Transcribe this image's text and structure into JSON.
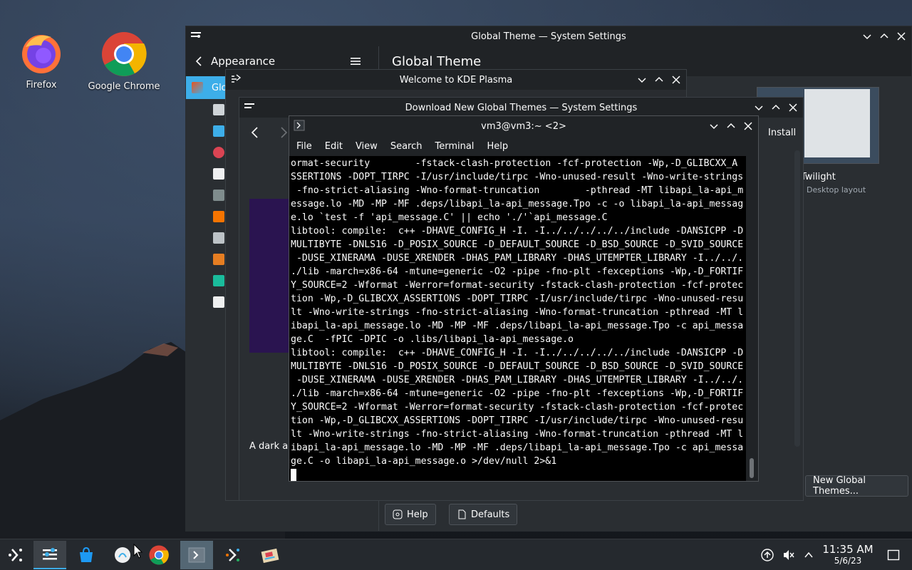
{
  "desktop": {
    "icons": [
      {
        "label": "Firefox"
      },
      {
        "label": "Google Chrome"
      }
    ]
  },
  "system_settings": {
    "title": "Global Theme — System Settings",
    "back_label": "Appearance",
    "page_title": "Global Theme",
    "sidebar_first_item": "Glo",
    "install_label": "Install",
    "theme_name": "ze Twilight",
    "theme_sub": "Desktop layout",
    "get_new_label": "New Global Themes...",
    "help_label": "Help",
    "defaults_label": "Defaults",
    "theme_desc_partial": "A dark an",
    "colors": {
      "accent": "#3daee9",
      "bg": "#202326",
      "panel": "#2a2e32"
    }
  },
  "welcome": {
    "title": "Welcome to KDE Plasma"
  },
  "download": {
    "title": "Download New Global Themes — System Settings"
  },
  "konsole": {
    "title": "vm3@vm3:~ <2>",
    "menu": [
      "File",
      "Edit",
      "View",
      "Search",
      "Terminal",
      "Help"
    ],
    "lines": [
      "ormat-security        -fstack-clash-protection -fcf-protection -Wp,-D_GLIBCXX_A",
      "SSERTIONS -DOPT_TIRPC -I/usr/include/tirpc -Wno-unused-result -Wno-write-strings",
      " -fno-strict-aliasing -Wno-format-truncation        -pthread -MT libapi_la-api_m",
      "essage.lo -MD -MP -MF .deps/libapi_la-api_message.Tpo -c -o libapi_la-api_messag",
      "e.lo `test -f 'api_message.C' || echo './'`api_message.C",
      "libtool: compile:  c++ -DHAVE_CONFIG_H -I. -I../../../../../include -DANSICPP -D",
      "MULTIBYTE -DNLS16 -D_POSIX_SOURCE -D_DEFAULT_SOURCE -D_BSD_SOURCE -D_SVID_SOURCE",
      " -DUSE_XINERAMA -DUSE_XRENDER -DHAS_PAM_LIBRARY -DHAS_UTEMPTER_LIBRARY -I../../.",
      "./lib -march=x86-64 -mtune=generic -O2 -pipe -fno-plt -fexceptions -Wp,-D_FORTIF",
      "Y_SOURCE=2 -Wformat -Werror=format-security -fstack-clash-protection -fcf-protec",
      "tion -Wp,-D_GLIBCXX_ASSERTIONS -DOPT_TIRPC -I/usr/include/tirpc -Wno-unused-resu",
      "lt -Wno-write-strings -fno-strict-aliasing -Wno-format-truncation -pthread -MT l",
      "ibapi_la-api_message.lo -MD -MP -MF .deps/libapi_la-api_message.Tpo -c api_messa",
      "ge.C  -fPIC -DPIC -o .libs/libapi_la-api_message.o",
      "libtool: compile:  c++ -DHAVE_CONFIG_H -I. -I../../../../../include -DANSICPP -D",
      "MULTIBYTE -DNLS16 -D_POSIX_SOURCE -D_DEFAULT_SOURCE -D_BSD_SOURCE -D_SVID_SOURCE",
      " -DUSE_XINERAMA -DUSE_XRENDER -DHAS_PAM_LIBRARY -DHAS_UTEMPTER_LIBRARY -I../../.",
      "./lib -march=x86-64 -mtune=generic -O2 -pipe -fno-plt -fexceptions -Wp,-D_FORTIF",
      "Y_SOURCE=2 -Wformat -Werror=format-security -fstack-clash-protection -fcf-protec",
      "tion -Wp,-D_GLIBCXX_ASSERTIONS -DOPT_TIRPC -I/usr/include/tirpc -Wno-unused-resu",
      "lt -Wno-write-strings -fno-strict-aliasing -Wno-format-truncation -pthread -MT l",
      "ibapi_la-api_message.lo -MD -MP -MF .deps/libapi_la-api_message.Tpo -c api_messa",
      "ge.C -o libapi_la-api_message.o >/dev/null 2>&1"
    ]
  },
  "taskbar": {
    "tasks": [
      {
        "icon": "app-launcher-icon"
      },
      {
        "icon": "system-settings-icon"
      },
      {
        "icon": "discover-store-icon"
      },
      {
        "icon": "kde-welcome-icon"
      },
      {
        "icon": "chrome-icon"
      },
      {
        "icon": "konsole-icon"
      },
      {
        "icon": "system-settings-icon"
      },
      {
        "icon": "ark-archive-icon"
      }
    ],
    "clock_time": "11:35 AM",
    "clock_date": "5/6/23"
  }
}
